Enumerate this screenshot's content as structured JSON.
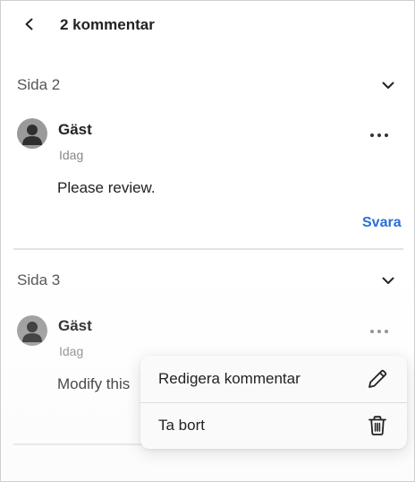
{
  "header": {
    "title": "2 kommentar",
    "back_icon": "chevron-left-icon"
  },
  "sections": [
    {
      "label": "Sida 2",
      "comment": {
        "author": "Gäst",
        "date": "Idag",
        "text": "Please review.",
        "reply_label": "Svara"
      }
    },
    {
      "label": "Sida 3",
      "comment": {
        "author": "Gäst",
        "date": "Idag",
        "text": "Modify this"
      }
    }
  ],
  "context_menu": {
    "items": [
      {
        "label": "Redigera kommentar",
        "icon": "pencil-icon"
      },
      {
        "label": "Ta bort",
        "icon": "trash-icon"
      }
    ]
  },
  "colors": {
    "link": "#2b6fd6",
    "avatar": "#9a9a9a"
  }
}
